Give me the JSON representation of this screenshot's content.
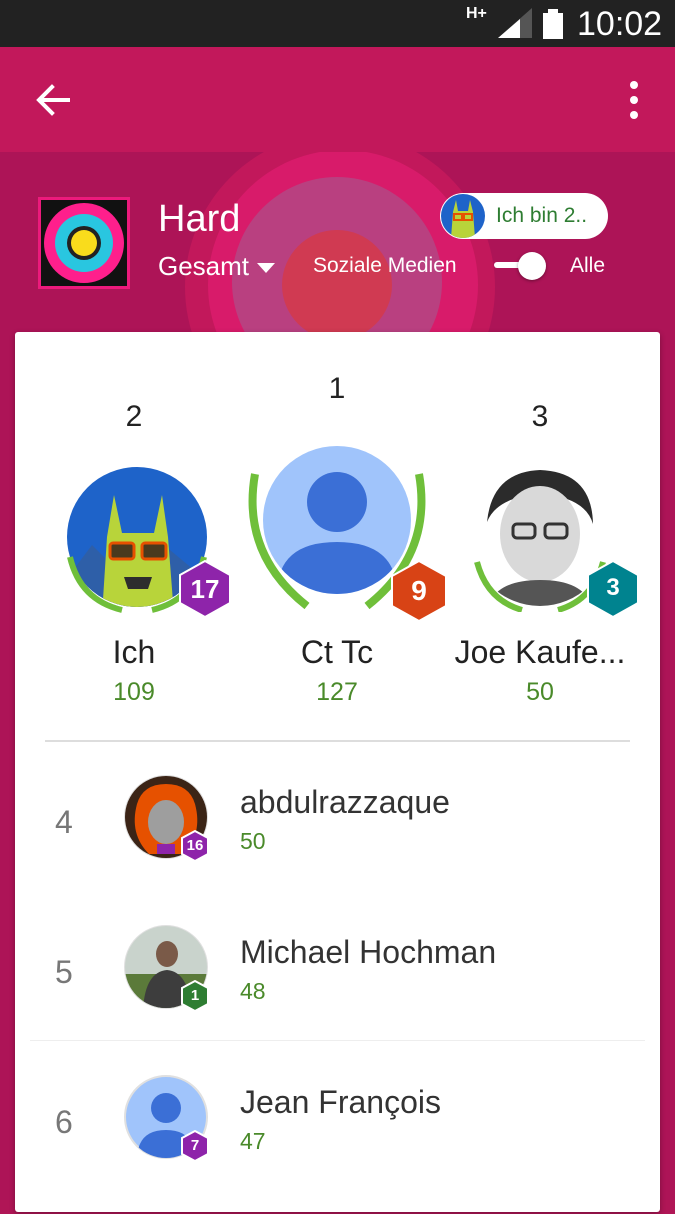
{
  "status_bar": {
    "network": "H+",
    "time": "10:02"
  },
  "game": {
    "title": "Hard",
    "filter": "Gesamt",
    "social_label": "Soziale Medien",
    "all_label": "Alle",
    "me_chip": "Ich bin 2.."
  },
  "podium": [
    {
      "rank": "2",
      "name": "Ich",
      "score": "109",
      "level": "17",
      "level_color": "#8e24aa"
    },
    {
      "rank": "1",
      "name": "Ct Tc",
      "score": "127",
      "level": "9",
      "level_color": "#d84315"
    },
    {
      "rank": "3",
      "name": "Joe Kaufe...",
      "score": "50",
      "level": "3",
      "level_color": "#00838f"
    }
  ],
  "list": [
    {
      "rank": "4",
      "name": "abdulrazzaque",
      "score": "50",
      "level": "16",
      "level_color": "#8e24aa"
    },
    {
      "rank": "5",
      "name": "Michael Hochman",
      "score": "48",
      "level": "1",
      "level_color": "#2e7d32"
    },
    {
      "rank": "6",
      "name": "Jean François",
      "score": "47",
      "level": "7",
      "level_color": "#8e24aa"
    }
  ],
  "colors": {
    "app_bar": "#c2185b",
    "background": "#ad1457",
    "score_green": "#4a8a2a"
  }
}
